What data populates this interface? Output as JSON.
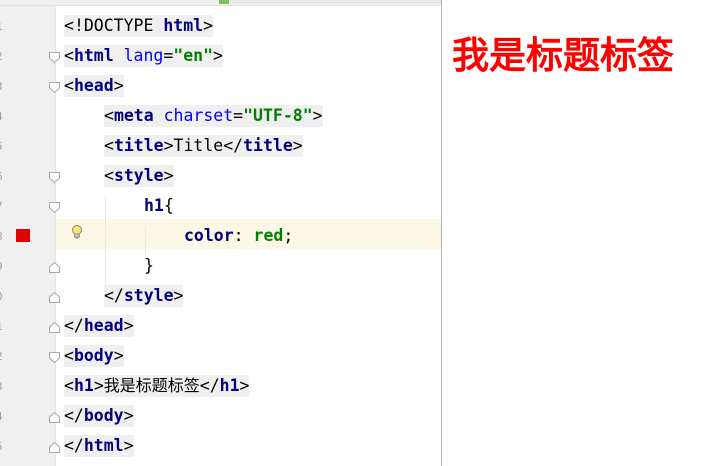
{
  "editor": {
    "lines": [
      [
        {
          "t": "<",
          "c": "pn"
        },
        {
          "t": "!DOCTYPE ",
          "c": "txt"
        },
        {
          "t": "html",
          "c": "tag"
        },
        {
          "t": ">",
          "c": "pn"
        }
      ],
      [
        {
          "t": "<",
          "c": "pn"
        },
        {
          "t": "html ",
          "c": "tag"
        },
        {
          "t": "lang",
          "c": "attr"
        },
        {
          "t": "=",
          "c": "pn"
        },
        {
          "t": "\"en\"",
          "c": "str"
        },
        {
          "t": ">",
          "c": "pn"
        }
      ],
      [
        {
          "t": "<",
          "c": "pn"
        },
        {
          "t": "head",
          "c": "tag"
        },
        {
          "t": ">",
          "c": "pn"
        }
      ],
      [
        {
          "t": "<",
          "c": "pn"
        },
        {
          "t": "meta ",
          "c": "tag"
        },
        {
          "t": "charset",
          "c": "attr"
        },
        {
          "t": "=",
          "c": "pn"
        },
        {
          "t": "\"UTF-8\"",
          "c": "str"
        },
        {
          "t": ">",
          "c": "pn"
        }
      ],
      [
        {
          "t": "<",
          "c": "pn"
        },
        {
          "t": "title",
          "c": "tag"
        },
        {
          "t": ">",
          "c": "pn"
        },
        {
          "t": "Title",
          "c": "txt"
        },
        {
          "t": "</",
          "c": "pn"
        },
        {
          "t": "title",
          "c": "tag"
        },
        {
          "t": ">",
          "c": "pn"
        }
      ],
      [
        {
          "t": "<",
          "c": "pn"
        },
        {
          "t": "style",
          "c": "tag"
        },
        {
          "t": ">",
          "c": "pn"
        }
      ],
      [
        {
          "t": "h1",
          "c": "sel"
        },
        {
          "t": "{",
          "c": "pn"
        }
      ],
      [
        {
          "t": "color",
          "c": "prop"
        },
        {
          "t": ": ",
          "c": "pn"
        },
        {
          "t": "red",
          "c": "val"
        },
        {
          "t": ";",
          "c": "pn"
        }
      ],
      [
        {
          "t": "}",
          "c": "pn"
        }
      ],
      [
        {
          "t": "</",
          "c": "pn"
        },
        {
          "t": "style",
          "c": "tag"
        },
        {
          "t": ">",
          "c": "pn"
        }
      ],
      [
        {
          "t": "</",
          "c": "pn"
        },
        {
          "t": "head",
          "c": "tag"
        },
        {
          "t": ">",
          "c": "pn"
        }
      ],
      [
        {
          "t": "<",
          "c": "pn"
        },
        {
          "t": "body",
          "c": "tag"
        },
        {
          "t": ">",
          "c": "pn"
        }
      ],
      [
        {
          "t": "<",
          "c": "pn"
        },
        {
          "t": "h1",
          "c": "tag"
        },
        {
          "t": ">",
          "c": "pn"
        },
        {
          "t": "我是标题标签",
          "c": "txt txt-cn"
        },
        {
          "t": "</",
          "c": "pn"
        },
        {
          "t": "h1",
          "c": "tag"
        },
        {
          "t": ">",
          "c": "pn"
        }
      ],
      [
        {
          "t": "</",
          "c": "pn"
        },
        {
          "t": "body",
          "c": "tag"
        },
        {
          "t": ">",
          "c": "pn"
        }
      ],
      [
        {
          "t": "</",
          "c": "pn"
        },
        {
          "t": "html",
          "c": "tag"
        },
        {
          "t": ">",
          "c": "pn"
        }
      ]
    ],
    "highlight_color": "#fcf8e5",
    "breakpoint_color": "#e00000"
  },
  "preview": {
    "heading": "我是标题标签",
    "heading_color": "#ff0000"
  }
}
